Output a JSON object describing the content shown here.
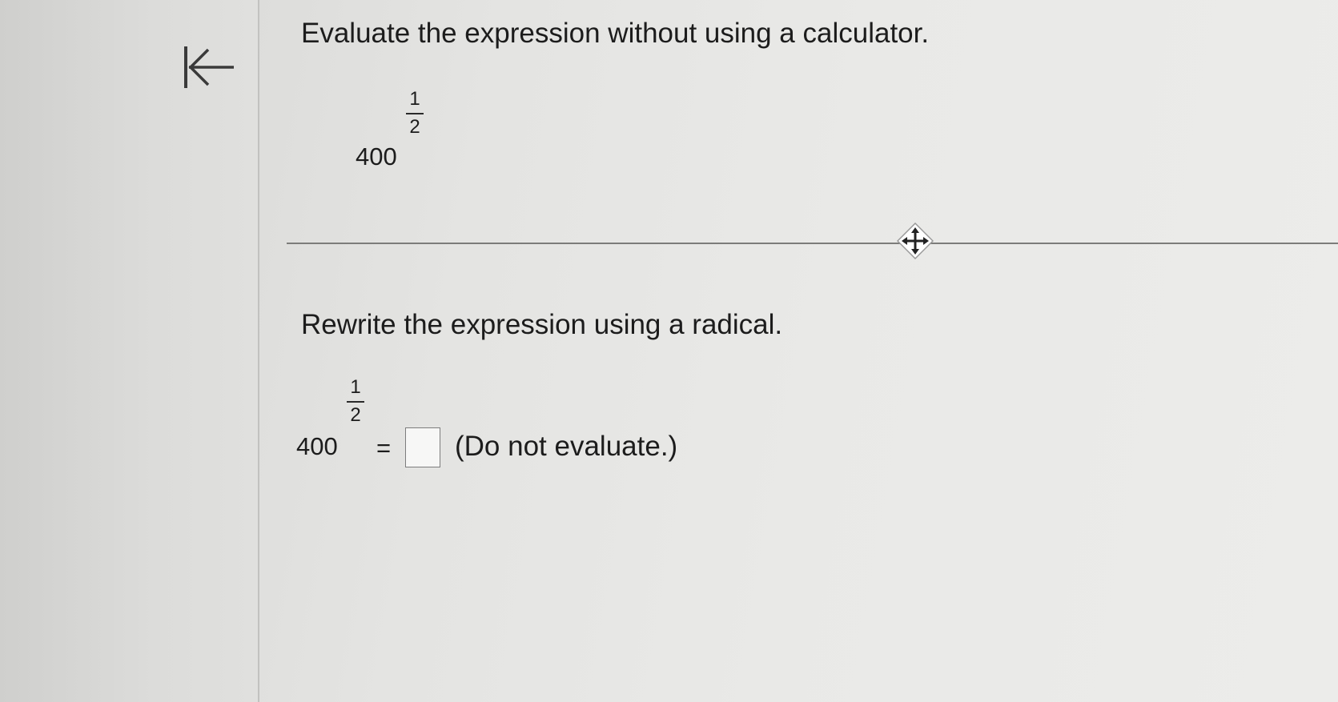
{
  "question": {
    "prompt": "Evaluate the expression without using a calculator.",
    "expression": {
      "base": "400",
      "exponent_numerator": "1",
      "exponent_denominator": "2"
    }
  },
  "part": {
    "prompt": "Rewrite the expression using a radical.",
    "expression": {
      "base": "400",
      "exponent_numerator": "1",
      "exponent_denominator": "2"
    },
    "equals": "=",
    "answer_value": "",
    "note": "(Do not evaluate.)"
  },
  "icons": {
    "collapse": "collapse-left-arrow-icon",
    "move": "move-handle-icon"
  }
}
